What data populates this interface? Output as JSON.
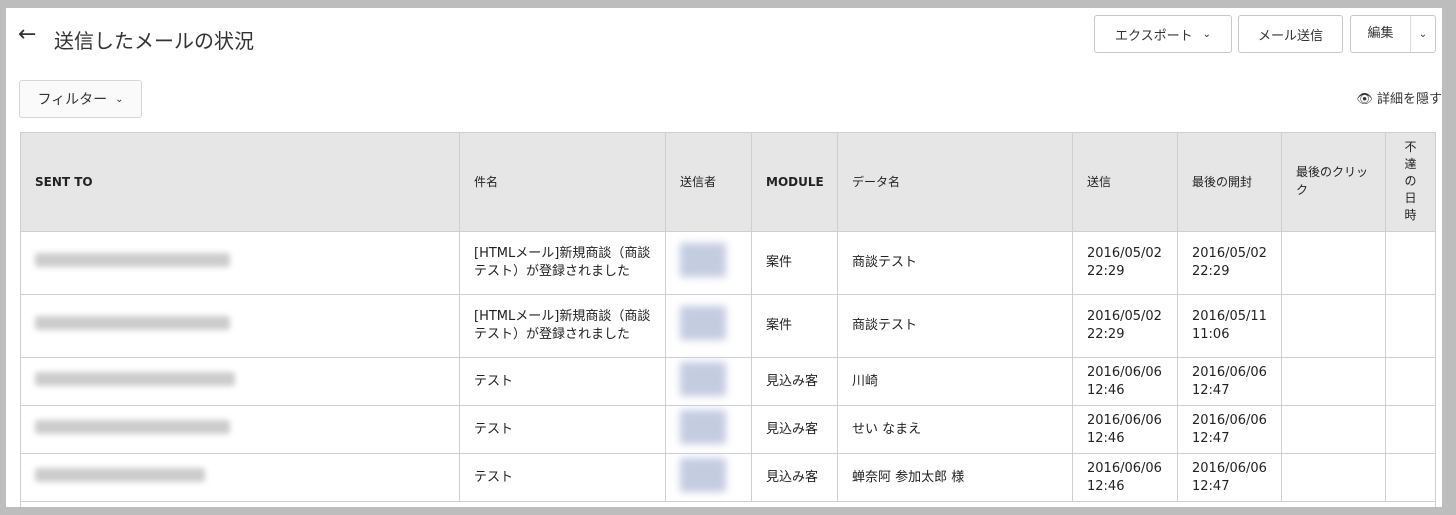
{
  "header": {
    "title": "送信したメールの状況",
    "export": "エクスポート",
    "send_mail": "メール送信",
    "edit": "編集"
  },
  "filter": "フィルター",
  "hide_details": "詳細を隠す",
  "columns": [
    "SENT TO",
    "件名",
    "送信者",
    "MODULE",
    "データ名",
    "送信",
    "最後の開封",
    "最後のクリック",
    "不達の日時"
  ],
  "rows": [
    {
      "subject": "[HTMLメール]新規商談（商談テスト）が登録されました",
      "module": "案件",
      "data": "商談テスト",
      "sent": "2016/05/02 22:29",
      "opened": "2016/05/02 22:29"
    },
    {
      "subject": "[HTMLメール]新規商談（商談テスト）が登録されました",
      "module": "案件",
      "data": "商談テスト",
      "sent": "2016/05/02 22:29",
      "opened": "2016/05/11 11:06"
    },
    {
      "subject": "テスト",
      "module": "見込み客",
      "data": "川崎",
      "sent": "2016/06/06 12:46",
      "opened": "2016/06/06 12:47"
    },
    {
      "subject": "テスト",
      "module": "見込み客",
      "data": "せい なまえ",
      "sent": "2016/06/06 12:46",
      "opened": "2016/06/06 12:47"
    },
    {
      "subject": "テスト",
      "module": "見込み客",
      "data": "蝉奈阿 参加太郎 様",
      "sent": "2016/06/06 12:46",
      "opened": "2016/06/06 12:47"
    }
  ]
}
